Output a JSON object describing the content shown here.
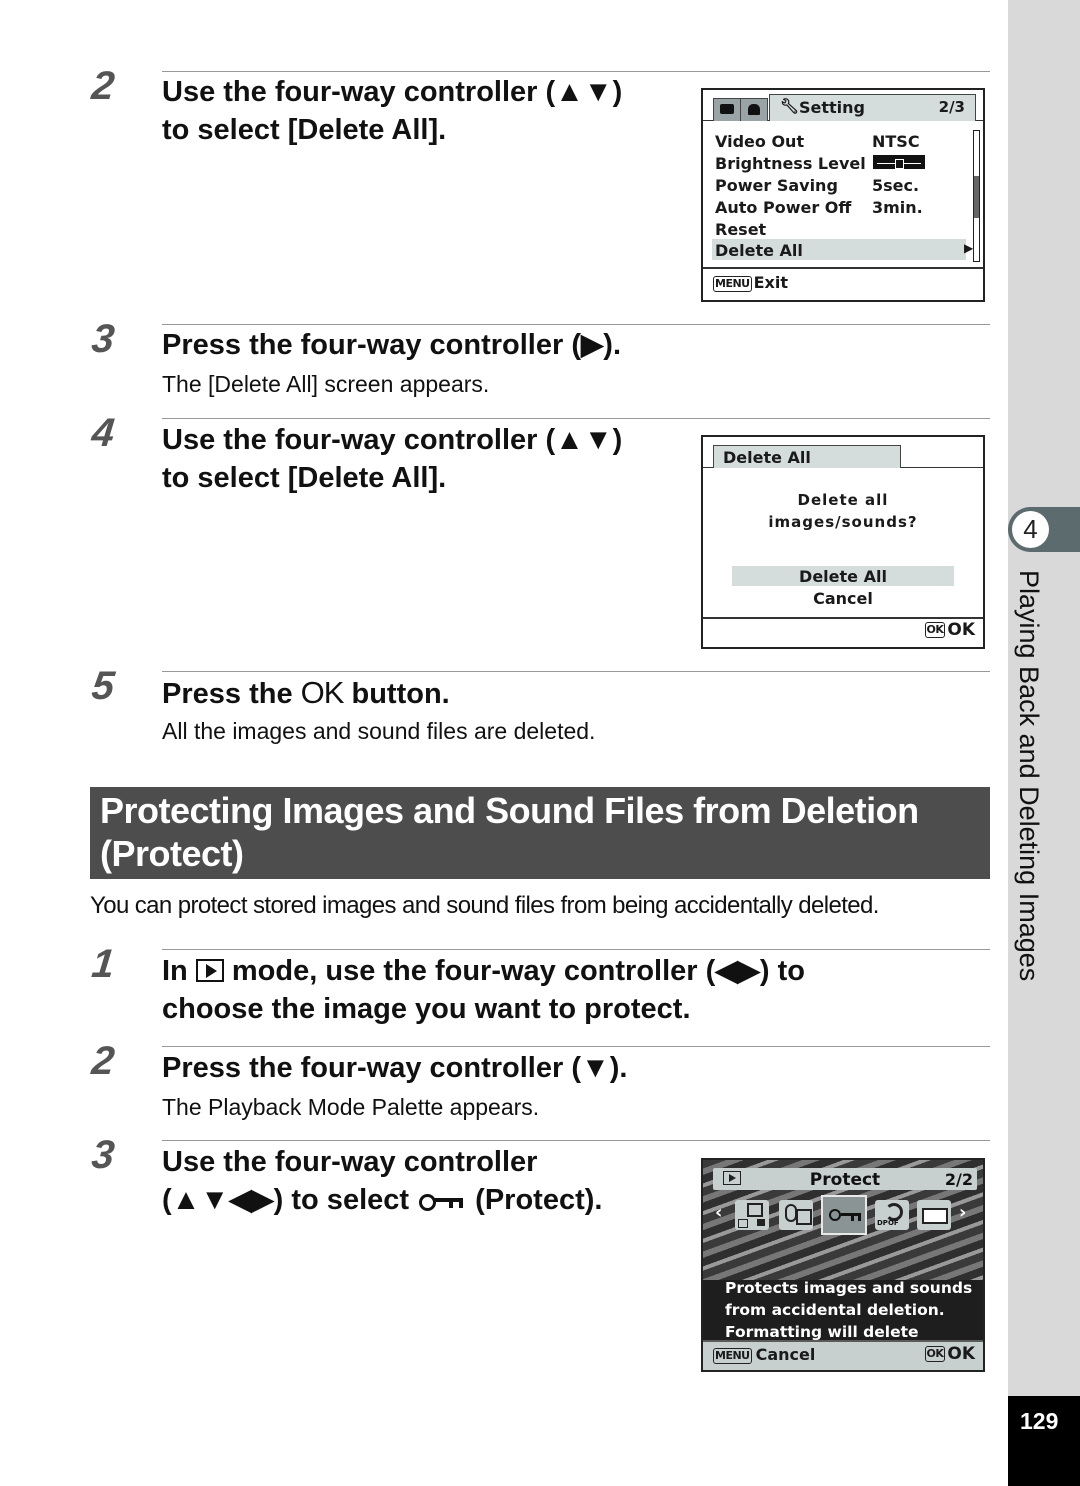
{
  "steps_part1": [
    {
      "num": "2",
      "line1": "Use the four-way controller (▲▼)",
      "line2": "to select [Delete All]."
    },
    {
      "num": "3",
      "line1": "Press the four-way controller (▶).",
      "body": "The [Delete All] screen appears."
    },
    {
      "num": "4",
      "line1": "Use the four-way controller (▲▼)",
      "line2": "to select [Delete All]."
    },
    {
      "num": "5",
      "line1_a": "Press the ",
      "line1_ok": "OK",
      "line1_b": " button.",
      "body": "All the images and sound files are deleted."
    }
  ],
  "setting_screen": {
    "tab_title": "Setting",
    "page": "2/3",
    "items": [
      {
        "label": "Video Out",
        "value": "NTSC"
      },
      {
        "label": "Brightness Level",
        "value": ""
      },
      {
        "label": "Power Saving",
        "value": "5sec."
      },
      {
        "label": "Auto Power Off",
        "value": "3min."
      },
      {
        "label": "Reset",
        "value": ""
      },
      {
        "label": "Delete All",
        "value": "",
        "selected": true
      }
    ],
    "menu_key": "MENU",
    "footer_label": "Exit"
  },
  "delete_all_screen": {
    "tab_title": "Delete All",
    "message_line1": "Delete all",
    "message_line2": "images/sounds?",
    "options": [
      "Delete All",
      "Cancel"
    ],
    "selected_option": "Delete All",
    "ok_key": "OK",
    "ok_label": "OK"
  },
  "section": {
    "title": "Protecting Images and Sound Files from Deletion (Protect)",
    "intro": "You can protect stored images and sound files from being accidentally deleted."
  },
  "steps_part2": [
    {
      "num": "1",
      "line1_a": "In ",
      "line1_b": " mode, use the four-way controller (◀▶) to",
      "line2": "choose the image you want to protect."
    },
    {
      "num": "2",
      "line1": "Press the four-way controller (▼).",
      "body": "The Playback Mode Palette appears."
    },
    {
      "num": "3",
      "line1": "Use the four-way controller",
      "line2_a": "(▲▼◀▶) to select ",
      "line2_b": " (Protect)."
    }
  ],
  "protect_screen": {
    "title": "Protect",
    "page": "2/2",
    "icons": [
      "resize-copy-icon",
      "voice-memo-icon",
      "protect-key-icon",
      "dpof-icon",
      "pentax-frame-icon"
    ],
    "dpof_label": "DPOF",
    "description_lines": [
      "Protects images and sounds",
      "from accidental deletion.",
      "Formatting will delete"
    ],
    "menu_key": "MENU",
    "cancel_label": "Cancel",
    "ok_key": "OK",
    "ok_label": "OK"
  },
  "sidebar": {
    "chapter_number": "4",
    "chapter_title": "Playing Back and Deleting Images",
    "page_number": "129"
  }
}
